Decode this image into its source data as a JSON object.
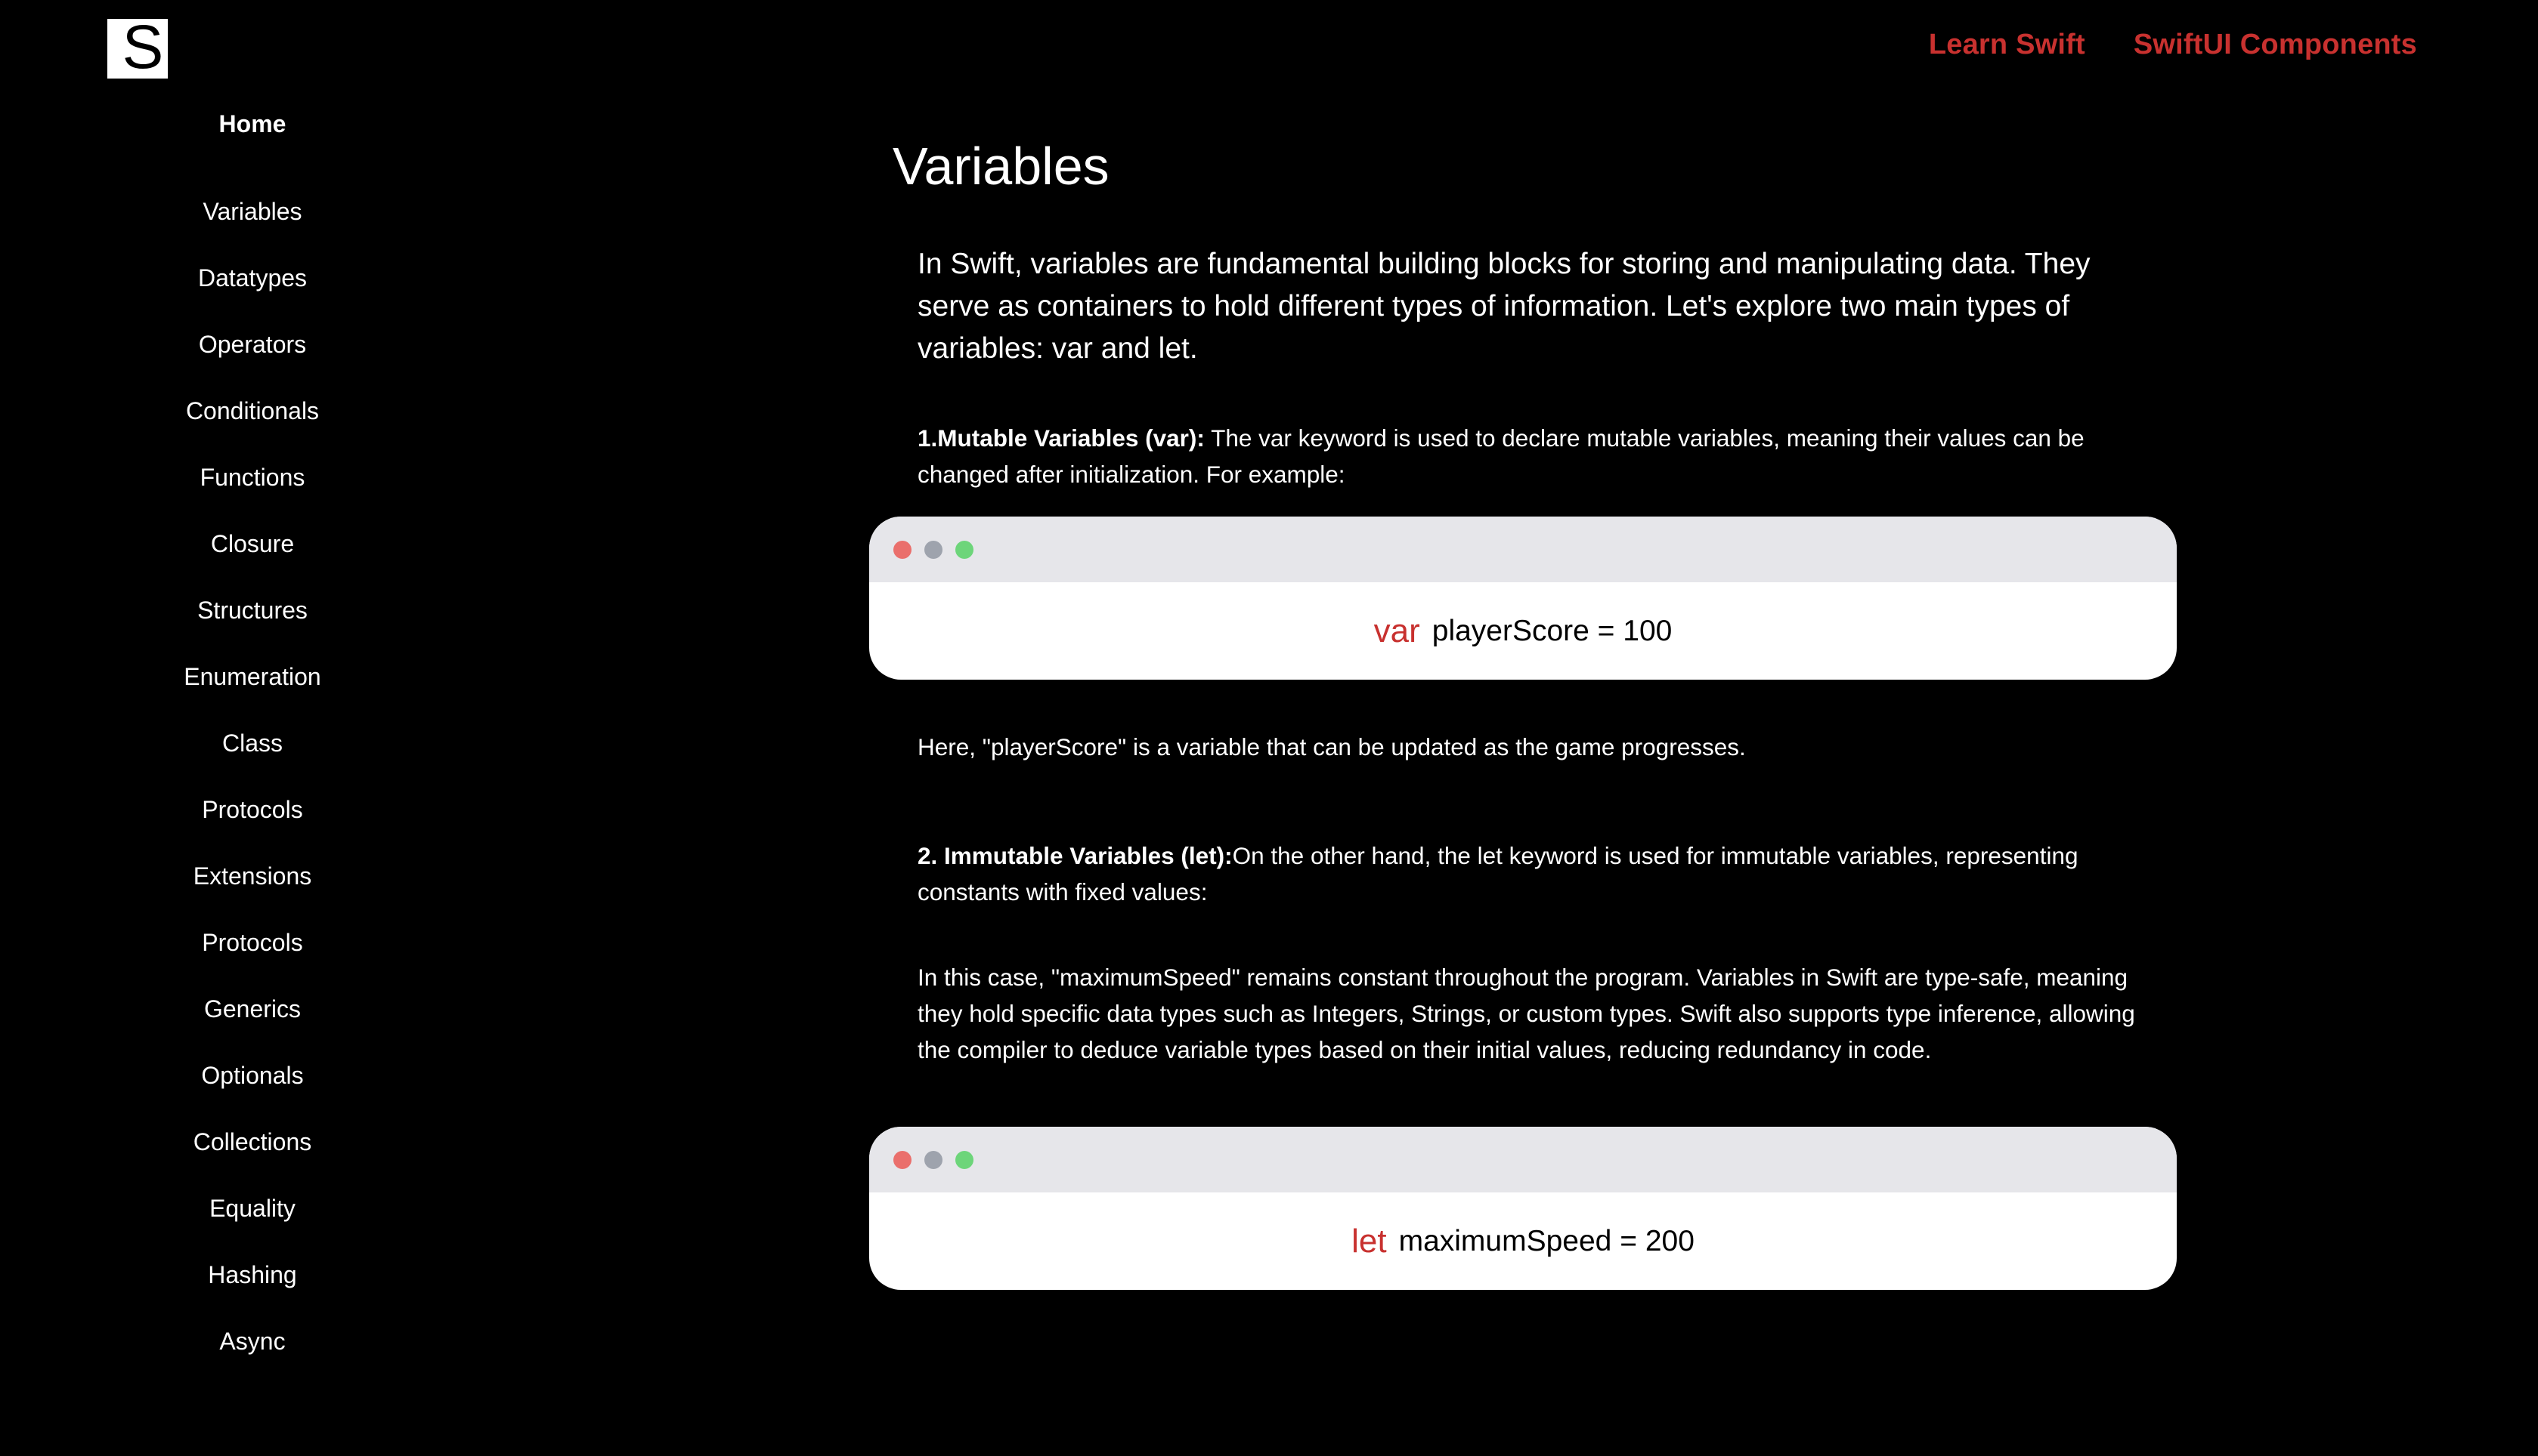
{
  "logo": {
    "letter": "S"
  },
  "topnav": [
    {
      "label": "Learn Swift"
    },
    {
      "label": "SwiftUI Components"
    }
  ],
  "sidebar": {
    "items": [
      {
        "label": "Home",
        "active": true
      },
      {
        "label": "Variables"
      },
      {
        "label": "Datatypes"
      },
      {
        "label": "Operators"
      },
      {
        "label": "Conditionals"
      },
      {
        "label": "Functions"
      },
      {
        "label": "Closure"
      },
      {
        "label": "Structures"
      },
      {
        "label": "Enumeration"
      },
      {
        "label": "Class"
      },
      {
        "label": "Protocols"
      },
      {
        "label": "Extensions"
      },
      {
        "label": "Protocols"
      },
      {
        "label": "Generics"
      },
      {
        "label": "Optionals"
      },
      {
        "label": "Collections"
      },
      {
        "label": "Equality"
      },
      {
        "label": "Hashing"
      },
      {
        "label": "Async"
      }
    ]
  },
  "main": {
    "title": "Variables",
    "intro": "In Swift, variables are fundamental building blocks for storing and manipulating data. They serve as containers to hold different types of information. Let's explore two main types of variables: var and let.",
    "mutable": {
      "heading": "1.Mutable Variables (var):",
      "text": " The var keyword is used to declare mutable variables, meaning their values can be changed after initialization. For example:"
    },
    "code1": {
      "keyword": "var",
      "statement": "playerScore = 100"
    },
    "mutable_note": "Here, \"playerScore\" is a variable that can be updated as the game progresses.",
    "immutable": {
      "heading": "2. Immutable Variables (let):",
      "text": "On the other hand, the let keyword is used for immutable variables, representing constants with fixed values:"
    },
    "immutable_note": "In this case, \"maximumSpeed\" remains constant throughout the program. Variables in Swift are type-safe, meaning they hold specific data types such as Integers, Strings, or custom types. Swift also supports type inference, allowing the compiler to deduce variable types based on their initial values, reducing redundancy in code.",
    "code2": {
      "keyword": "let",
      "statement": "maximumSpeed = 200"
    }
  },
  "colors": {
    "background": "#000000",
    "accent": "#c8312f",
    "code_window": "#ffffff",
    "code_bar": "#e6e6ea"
  }
}
